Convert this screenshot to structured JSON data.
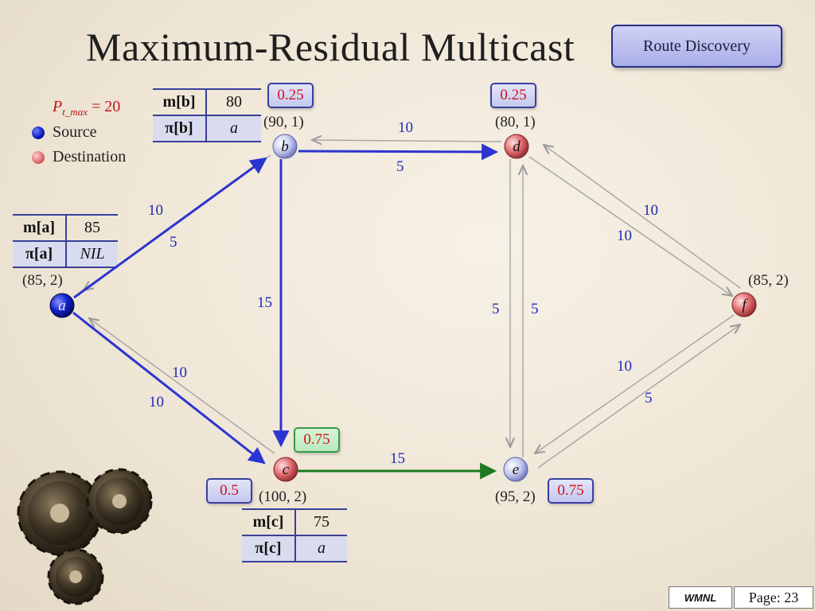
{
  "slide": {
    "title": "Maximum-Residual Multicast",
    "nav_button": "Route Discovery",
    "footer_lab": "WMNL",
    "footer_page": "Page: 23"
  },
  "legend": {
    "p_symbol": "P",
    "p_sub": "t_max",
    "p_value": "= 20",
    "source": "Source",
    "destination": "Destination"
  },
  "nodes": {
    "a": {
      "name": "a",
      "coords": "(85, 2)",
      "role": "source"
    },
    "b": {
      "name": "b",
      "coords": "(90, 1)",
      "role": "relay",
      "badge": "0.25"
    },
    "c": {
      "name": "c",
      "coords": "(100, 2)",
      "role": "destination",
      "badge_top": "0.75",
      "badge_left": "0.5"
    },
    "d": {
      "name": "d",
      "coords": "(80, 1)",
      "role": "destination",
      "badge": "0.25"
    },
    "e": {
      "name": "e",
      "coords": "(95, 2)",
      "role": "relay",
      "badge": "0.75"
    },
    "f": {
      "name": "f",
      "coords": "(85, 2)",
      "role": "destination"
    }
  },
  "tables": {
    "a": {
      "m_label": "m[a]",
      "m_value": "85",
      "pi_label": "π[a]",
      "pi_value": "NIL"
    },
    "b": {
      "m_label": "m[b]",
      "m_value": "80",
      "pi_label": "π[b]",
      "pi_value": "a"
    },
    "c": {
      "m_label": "m[c]",
      "m_value": "75",
      "pi_label": "π[c]",
      "pi_value": "a"
    }
  },
  "edges": {
    "ab_fwd": "5",
    "ab_back": "10",
    "bd_fwd": "5",
    "bd_back": "10",
    "bc": "15",
    "ac_fwd": "10",
    "ac_back": "10",
    "ce": "15",
    "de_down": "5",
    "de_up": "5",
    "df_fwd": "10",
    "df_back": "10",
    "ef_fwd": "5",
    "ef_back": "10"
  },
  "colors": {
    "selected_path": "#2c35d0",
    "candidate_path": "#1e7a1e",
    "residual_path": "#a8a8a8",
    "badge_text": "#d01218"
  }
}
